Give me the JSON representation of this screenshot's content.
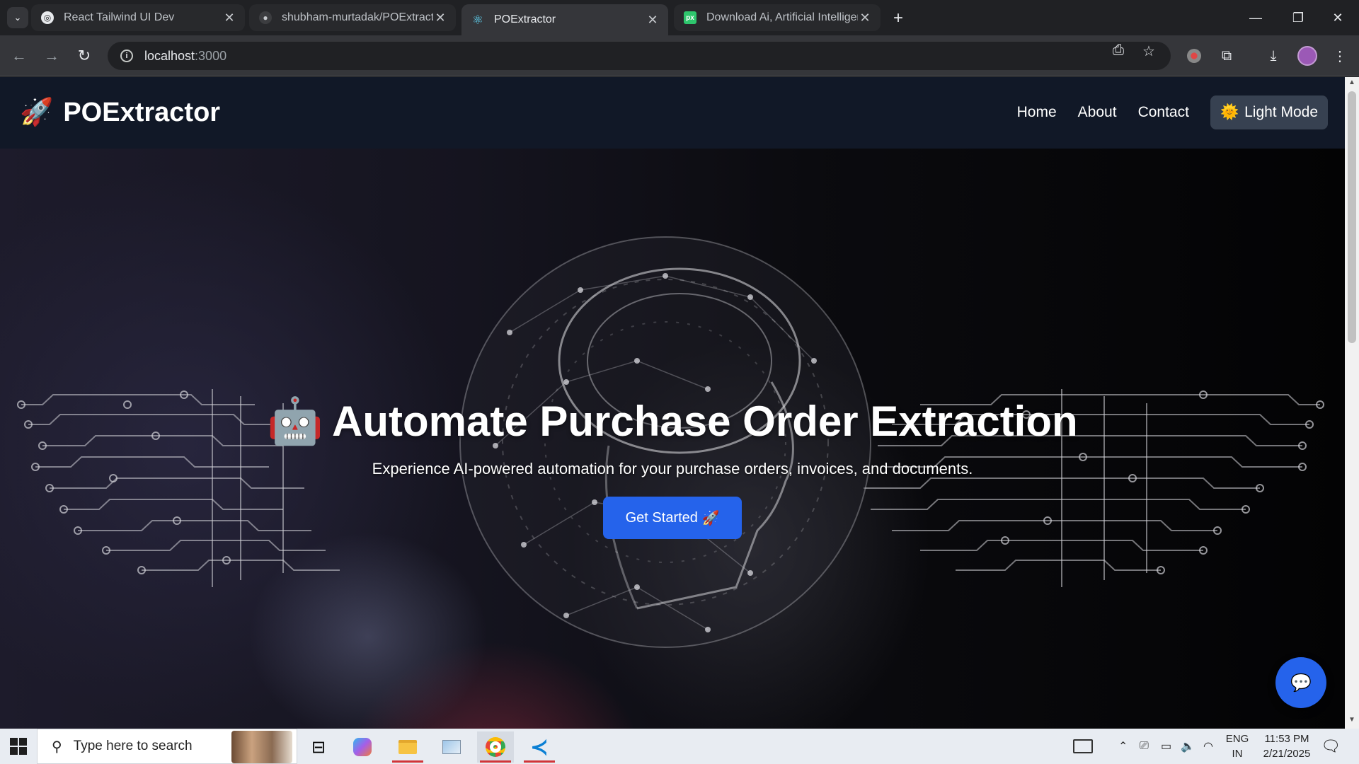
{
  "browser": {
    "tabs": [
      {
        "title": "React Tailwind UI Dev",
        "active": false
      },
      {
        "title": "shubham-murtadak/POExtractor",
        "active": false
      },
      {
        "title": "POExtractor",
        "active": true
      },
      {
        "title": "Download Ai, Artificial Intelligence",
        "active": false
      }
    ],
    "url_host": "localhost",
    "url_port": ":3000"
  },
  "page": {
    "brand_name": "POExtractor",
    "brand_icon": "🚀",
    "nav": {
      "home": "Home",
      "about": "About",
      "contact": "Contact",
      "mode_icon": "🌞",
      "mode_label": "Light Mode"
    },
    "hero": {
      "icon": "🤖",
      "title": "Automate Purchase Order Extraction",
      "subtitle": "Experience AI-powered automation for your purchase orders, invoices, and documents.",
      "cta_label": "Get Started",
      "cta_icon": "🚀"
    }
  },
  "taskbar": {
    "search_placeholder": "Type here to search",
    "lang_line1": "ENG",
    "lang_line2": "IN",
    "time": "11:53 PM",
    "date": "2/21/2025"
  },
  "colors": {
    "accent": "#2563eb",
    "navbar_bg": "#111827",
    "mode_button_bg": "#374151"
  }
}
